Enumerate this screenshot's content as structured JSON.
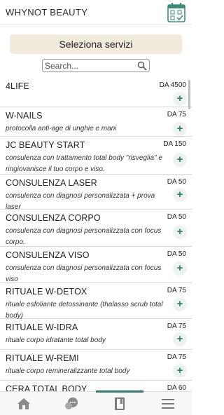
{
  "header": {
    "title": "WHYNOT BEAUTY",
    "calendar_icon": "calendar-check-icon"
  },
  "select_button": {
    "label": "Seleziona servizi"
  },
  "search": {
    "placeholder": "Search...",
    "value": "",
    "icon": "search-icon"
  },
  "services": [
    {
      "name": "4LIFE",
      "price": "DA 4500",
      "desc": ""
    },
    {
      "name": "W-NAILS",
      "price": "DA 75",
      "desc": "protocolla anti-age di unghie e mani"
    },
    {
      "name": "JC BEAUTY START",
      "price": "DA 150",
      "desc": "consulenza con trattamento total body \"risveglia\" e ringiovanisce il tuo corpo e viso."
    },
    {
      "name": "CONSULENZA LASER",
      "price": "DA 50",
      "desc": "consulenza con diagnosi personalizzata + prova laser"
    },
    {
      "name": "CONSULENZA CORPO",
      "price": "DA 50",
      "desc": "consulenza con diagnosi personalizzata con focus corpo."
    },
    {
      "name": "CONSULENZA VISO",
      "price": "DA 50",
      "desc": "consulenza con diagnosi personalizzata con focus viso"
    },
    {
      "name": "RITUALE W-DETOX",
      "price": "DA 75",
      "desc": "rituale esfoliante detossinante (thalasso scrub total body)"
    },
    {
      "name": "RITUALE W-IDRA",
      "price": "DA 75",
      "desc": "rituale corpo idratante total body"
    },
    {
      "name": "RITUALE W-REMI",
      "price": "DA 75",
      "desc": "rituale corpo remineralizzante total body"
    },
    {
      "name": "CERA TOTAL BODY",
      "price": "DA 60",
      "desc": ""
    }
  ],
  "add_symbol": "+",
  "bottom_nav": [
    {
      "name": "home",
      "icon": "home-icon"
    },
    {
      "name": "chat",
      "icon": "chat-bubble-icon"
    },
    {
      "name": "booking",
      "icon": "book-icon",
      "active": true
    },
    {
      "name": "menu",
      "icon": "hamburger-menu-icon"
    }
  ],
  "colors": {
    "accent": "#2f7a6a",
    "button_bg": "#f2eadb",
    "add_bg": "#edf3f1"
  }
}
